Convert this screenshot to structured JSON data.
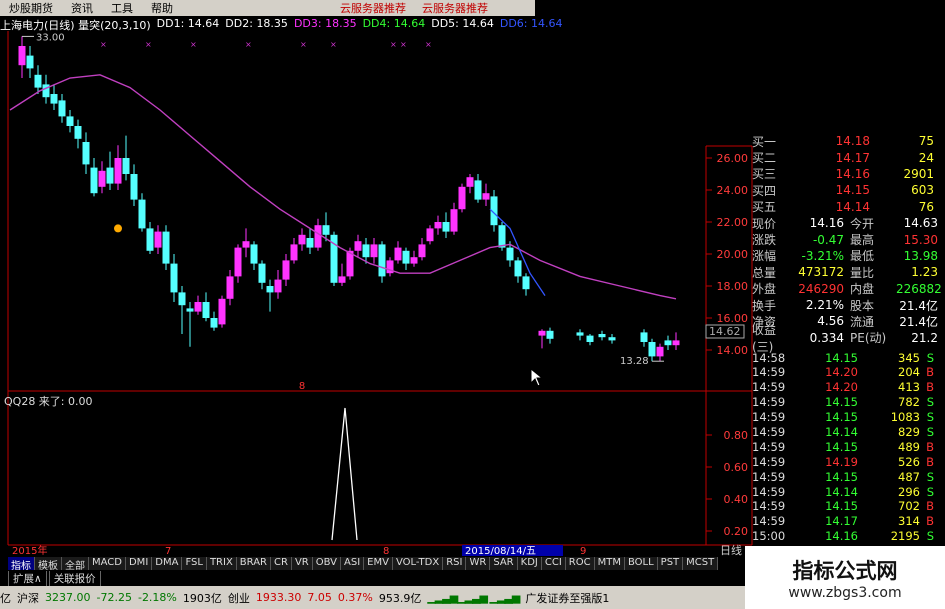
{
  "menu": {
    "items": [
      "炒股期货",
      "资讯",
      "工具",
      "帮助"
    ],
    "red_items": [
      "云服务器推荐",
      "云服务器推荐"
    ]
  },
  "infobar": {
    "title": "上海电力(日线) 量突(20,3,10)",
    "dd1": "DD1: 14.64",
    "dd2": "DD2: 18.35",
    "dd3": "DD3: 18.35",
    "dd4": "DD4: 14.64",
    "dd5": "DD5: 14.64",
    "dd6": "DD6: 14.64",
    "colors": {
      "dd1": "#ffffff",
      "dd2": "#ffffff",
      "dd3": "#ff33ff",
      "dd4": "#33ff33",
      "dd5": "#ffffff",
      "dd6": "#3355ff"
    }
  },
  "chart": {
    "high_label": "33.00",
    "low_label": "13.28",
    "marker_8": "8",
    "price_ticks": [
      "26.00",
      "24.00",
      "22.00",
      "20.00",
      "18.00",
      "16.00",
      "14.00"
    ],
    "current_price": "14.62",
    "date_ticks": [
      "2015年",
      "7",
      "8",
      "9"
    ],
    "date_cursor": "2015/08/14/五",
    "period_label": "日线",
    "colors": {
      "up": "#ff33ff",
      "down": "#55ffff",
      "ma": "#c040c0",
      "axis": "#c00000"
    }
  },
  "indicator": {
    "title": "QQ28 来了: 0.00",
    "ticks": [
      "0.80",
      "0.60",
      "0.40",
      "0.20"
    ]
  },
  "quote": {
    "book": [
      {
        "label": "买一",
        "price": "14.18",
        "vol": "75"
      },
      {
        "label": "买二",
        "price": "14.17",
        "vol": "24"
      },
      {
        "label": "买三",
        "price": "14.16",
        "vol": "2901"
      },
      {
        "label": "买四",
        "price": "14.15",
        "vol": "603"
      },
      {
        "label": "买五",
        "price": "14.14",
        "vol": "76"
      }
    ],
    "stats": [
      {
        "l1": "现价",
        "v1": "14.16",
        "c1": "#ffffff",
        "l2": "今开",
        "v2": "14.63",
        "c2": "#ffffff"
      },
      {
        "l1": "涨跌",
        "v1": "-0.47",
        "c1": "#33ff33",
        "l2": "最高",
        "v2": "15.30",
        "c2": "#ff3333"
      },
      {
        "l1": "涨幅",
        "v1": "-3.21%",
        "c1": "#33ff33",
        "l2": "最低",
        "v2": "13.98",
        "c2": "#33ff33"
      },
      {
        "l1": "总量",
        "v1": "473172",
        "c1": "#ffff33",
        "l2": "量比",
        "v2": "1.23",
        "c2": "#ffff33"
      },
      {
        "l1": "外盘",
        "v1": "246290",
        "c1": "#ff3333",
        "l2": "内盘",
        "v2": "226882",
        "c2": "#33ff33"
      },
      {
        "l1": "换手",
        "v1": "2.21%",
        "c1": "#ffffff",
        "l2": "股本",
        "v2": "21.4亿",
        "c2": "#ffffff"
      },
      {
        "l1": "净资",
        "v1": "4.56",
        "c1": "#ffffff",
        "l2": "流通",
        "v2": "21.4亿",
        "c2": "#ffffff"
      },
      {
        "l1": "收益(三)",
        "v1": "0.334",
        "c1": "#ffffff",
        "l2": "PE(动)",
        "v2": "21.2",
        "c2": "#ffffff"
      }
    ],
    "trades": [
      {
        "t": "14:58",
        "p": "14.15",
        "v": "345",
        "s": "S"
      },
      {
        "t": "14:59",
        "p": "14.20",
        "v": "204",
        "s": "B"
      },
      {
        "t": "14:59",
        "p": "14.20",
        "v": "413",
        "s": "B"
      },
      {
        "t": "14:59",
        "p": "14.15",
        "v": "782",
        "s": "S"
      },
      {
        "t": "14:59",
        "p": "14.15",
        "v": "1083",
        "s": "S"
      },
      {
        "t": "14:59",
        "p": "14.14",
        "v": "829",
        "s": "S"
      },
      {
        "t": "14:59",
        "p": "14.15",
        "v": "489",
        "s": "B"
      },
      {
        "t": "14:59",
        "p": "14.19",
        "v": "526",
        "s": "B"
      },
      {
        "t": "14:59",
        "p": "14.15",
        "v": "487",
        "s": "S"
      },
      {
        "t": "14:59",
        "p": "14.14",
        "v": "296",
        "s": "S"
      },
      {
        "t": "14:59",
        "p": "14.15",
        "v": "702",
        "s": "B"
      },
      {
        "t": "14:59",
        "p": "14.17",
        "v": "314",
        "s": "B"
      },
      {
        "t": "15:00",
        "p": "14.16",
        "v": "2195",
        "s": "S"
      }
    ]
  },
  "tabs": [
    "指标",
    "模板",
    "全部",
    "MACD",
    "DMI",
    "DMA",
    "FSL",
    "TRIX",
    "BRAR",
    "CR",
    "VR",
    "OBV",
    "ASI",
    "EMV",
    "VOL-TDX",
    "RSI",
    "WR",
    "SAR",
    "KDJ",
    "CCI",
    "ROC",
    "MTM",
    "BOLL",
    "PST",
    "MCST"
  ],
  "subtabs": [
    "扩展∧",
    "关联报价"
  ],
  "status": {
    "prefix": "亿",
    "sh_label": "沪深",
    "sh_value": "3237.00",
    "sh_change": "-72.25",
    "sh_pct": "-2.18%",
    "sh_amount": "1903亿",
    "cy_label": "创业",
    "cy_value": "1933.30",
    "cy_change": "7.05",
    "cy_pct": "0.37%",
    "cy_amount": "953.9亿",
    "broker": "广发证券至强版1"
  },
  "watermark": {
    "line1": "指标公式网",
    "line2": "www.zbgs3.com"
  }
}
